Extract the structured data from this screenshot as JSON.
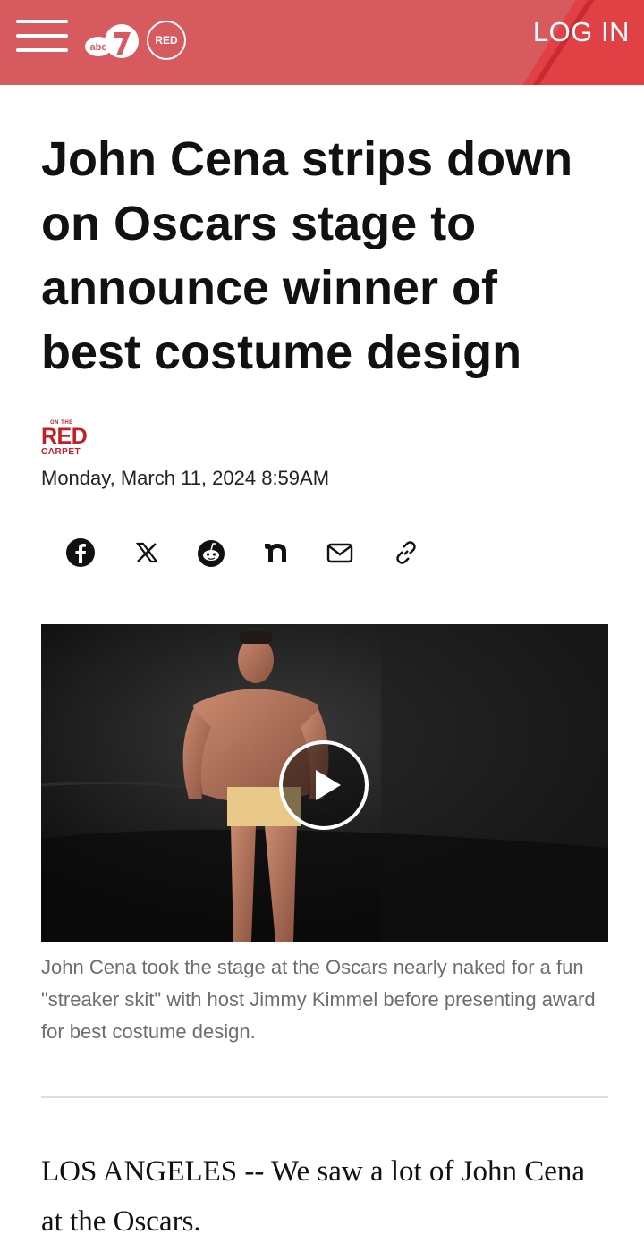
{
  "header": {
    "background_color": "#d65a5e",
    "menu_icon": "hamburger-menu-icon",
    "station_logo": "abc7-logo",
    "show_logo": "on-the-red-carpet-logo",
    "show_logo_text": "RED",
    "login_label": "LOG IN"
  },
  "article": {
    "headline": "John Cena strips down on Oscars stage to announce winner of best costume design",
    "byline_logo": {
      "top": "ON THE",
      "main": "RED",
      "bottom": "CARPET"
    },
    "date": "Monday, March 11, 2024 8:59AM",
    "share_icons": [
      "facebook-icon",
      "x-icon",
      "reddit-icon",
      "nextdoor-icon",
      "email-icon",
      "copy-link-icon"
    ],
    "video": {
      "play_icon": "play-icon",
      "caption": "John Cena took the stage at the Oscars nearly naked for a fun \"streaker skit\" with host Jimmy Kimmel before presenting award for best costume design."
    },
    "body_first_paragraph": "LOS ANGELES -- We saw a lot of John Cena at the Oscars."
  },
  "colors": {
    "accent_red": "#c21f26",
    "caption_gray": "#6d6d6d"
  }
}
